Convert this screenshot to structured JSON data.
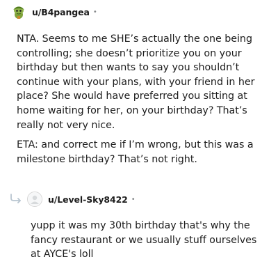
{
  "comments": [
    {
      "username": "u/B4pangea",
      "separator": "•",
      "avatar_icon": "snoo-avatar-green-hat-icon",
      "paragraphs": [
        "NTA. Seems to me SHE’s actually the one being controlling; she doesn’t prioritize you on your birthday but then wants to say you shouldn’t continue with your plans, with your friend in her place? She would have preferred you sitting at home waiting for her, on your birthday? That’s really not very nice.",
        "ETA: and correct me if I’m wrong, but this was a milestone birthday? That’s not right."
      ]
    },
    {
      "username": "u/Level-Sky8422",
      "separator": "•",
      "avatar_icon": "default-avatar-icon",
      "reply_icon": "reply-arrow-icon",
      "paragraphs": [
        "yupp it was my 30th birthday that's why the fancy restaurant or we usually stuff ourselves at AYCE's loll"
      ]
    }
  ],
  "colors": {
    "text": "#1c1c1c",
    "meta": "#878a8c",
    "avatar_green": "#6b8e23",
    "reply_arrow": "#b8c5d0"
  }
}
